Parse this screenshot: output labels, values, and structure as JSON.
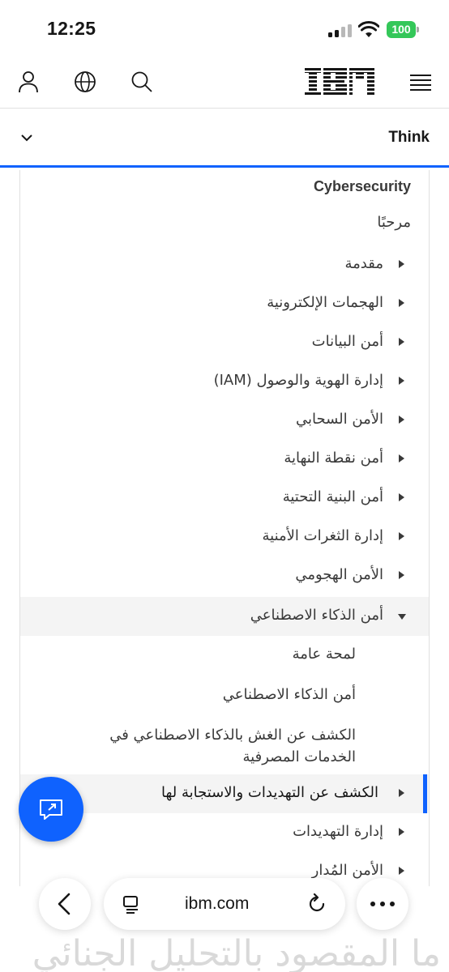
{
  "status_bar": {
    "time": "12:25",
    "battery": "100"
  },
  "masthead": {
    "icons": [
      "user-icon",
      "globe-icon",
      "search-icon",
      "ibm-logo",
      "menu-icon"
    ]
  },
  "think_bar": {
    "label": "Think"
  },
  "panel": {
    "title": "Cybersecurity",
    "welcome": "مرحبًا",
    "items": [
      {
        "label": "مقدمة"
      },
      {
        "label": "الهجمات الإلكترونية"
      },
      {
        "label": "أمن البيانات"
      },
      {
        "label": "إدارة الهوية والوصول (IAM)"
      },
      {
        "label": "الأمن السحابي"
      },
      {
        "label": "أمن نقطة النهاية"
      },
      {
        "label": "أمن البنية التحتية"
      },
      {
        "label": "إدارة الثغرات الأمنية"
      },
      {
        "label": "الأمن الهجومي"
      },
      {
        "label": "أمن الذكاء الاصطناعي"
      }
    ],
    "sub_items": [
      {
        "label": "لمحة عامة"
      },
      {
        "label": "أمن الذكاء الاصطناعي"
      },
      {
        "label": "الكشف عن الغش بالذكاء الاصطناعي في الخدمات المصرفية"
      }
    ],
    "active_item": {
      "label": "الكشف عن التهديدات والاستجابة لها"
    },
    "after_items": [
      {
        "label": "إدارة التهديدات"
      },
      {
        "label": "الأمن المُدار"
      }
    ]
  },
  "safari": {
    "address": "ibm.com",
    "behind_text": "ما المقصود بالتحليل الجنائي"
  },
  "colors": {
    "accent": "#0f62fe",
    "battery": "#34c759"
  }
}
